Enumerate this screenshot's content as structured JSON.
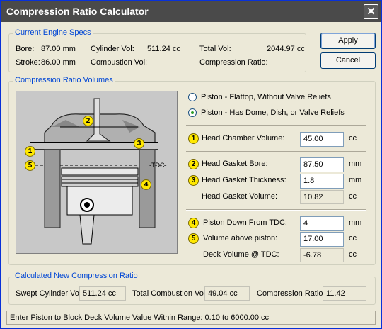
{
  "window": {
    "title": "Compression Ratio Calculator",
    "close_glyph": "✕"
  },
  "buttons": {
    "apply": "Apply",
    "cancel": "Cancel"
  },
  "engine_specs": {
    "title": "Current Engine Specs",
    "bore_label": "Bore:",
    "bore_value": "87.00 mm",
    "stroke_label": "Stroke:",
    "stroke_value": "86.00 mm",
    "cyl_vol_label": "Cylinder Vol:",
    "cyl_vol_value": "511.24 cc",
    "comb_vol_label": "Combustion Vol:",
    "comb_vol_value": "",
    "total_vol_label": "Total Vol:",
    "total_vol_value": "2044.97 cc",
    "comp_ratio_label": "Compression Ratio:",
    "comp_ratio_value": ""
  },
  "volumes": {
    "title": "Compression Ratio Volumes",
    "radio_flattop": "Piston - Flattop, Without Valve Reliefs",
    "radio_dome": "Piston - Has Dome, Dish, or Valve Reliefs",
    "selected": "dome",
    "head_chamber_label": "Head Chamber Volume:",
    "head_chamber_value": "45.00",
    "head_chamber_unit": "cc",
    "gasket_bore_label": "Head Gasket Bore:",
    "gasket_bore_value": "87.50",
    "gasket_bore_unit": "mm",
    "gasket_thick_label": "Head Gasket Thickness:",
    "gasket_thick_value": "1.8",
    "gasket_thick_unit": "mm",
    "gasket_vol_label": "Head Gasket Volume:",
    "gasket_vol_value": "10.82",
    "gasket_vol_unit": "cc",
    "piston_down_label": "Piston Down From TDC:",
    "piston_down_value": "4",
    "piston_down_unit": "mm",
    "vol_above_label": "Volume above piston:",
    "vol_above_value": "17.00",
    "vol_above_unit": "cc",
    "deck_vol_label": "Deck Volume @ TDC:",
    "deck_vol_value": "-6.78",
    "deck_vol_unit": "cc",
    "badges": {
      "n1": "1",
      "n2": "2",
      "n3": "3",
      "n4": "4",
      "n5": "5"
    },
    "diagram_tdc": "-TDC-"
  },
  "calculated": {
    "title": "Calculated New Compression Ratio",
    "swept_label": "Swept Cylinder Vol:",
    "swept_value": "511.24 cc",
    "total_comb_label": "Total Combustion Vol:",
    "total_comb_value": "49.04 cc",
    "ratio_label": "Compression Ratio:",
    "ratio_value": "11.42"
  },
  "status": "Enter Piston to Block Deck Volume Value Within Range: 0.10 to 6000.00 cc",
  "colors": {
    "badge": "#ffe800",
    "group_title": "#0046d5",
    "title_bar": "#4a4a4a"
  }
}
